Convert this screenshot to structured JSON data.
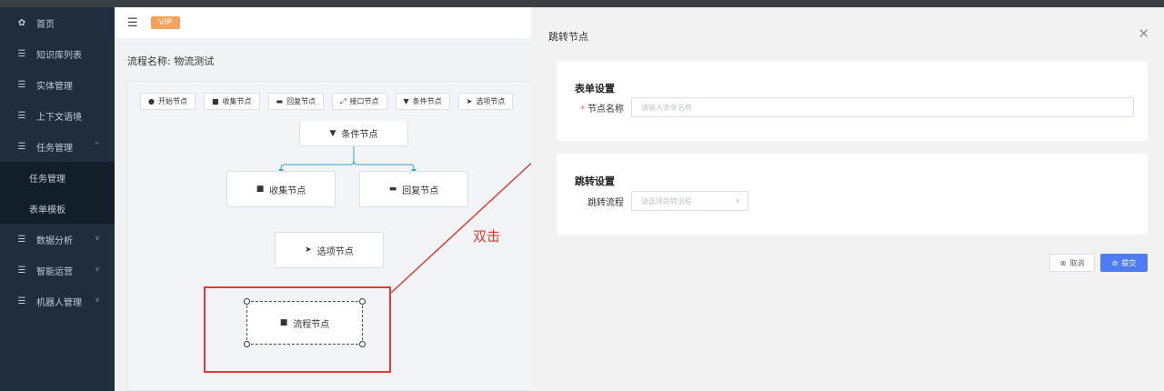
{
  "sidebar": {
    "items": [
      {
        "icon": "dashboard-icon",
        "glyph": "✿",
        "label": "首页"
      },
      {
        "icon": "list-icon",
        "glyph": "☰",
        "label": "知识库列表"
      },
      {
        "icon": "list-icon",
        "glyph": "☰",
        "label": "实体管理"
      },
      {
        "icon": "list-icon",
        "glyph": "☰",
        "label": "上下文语境"
      },
      {
        "icon": "list-icon",
        "glyph": "☰",
        "label": "任务管理",
        "expanded": true
      }
    ],
    "sub_items": [
      "任务管理",
      "表单模板"
    ],
    "items_after": [
      {
        "icon": "list-icon",
        "glyph": "☰",
        "label": "数据分析"
      },
      {
        "icon": "list-icon",
        "glyph": "☰",
        "label": "智能运营"
      },
      {
        "icon": "list-icon",
        "glyph": "☰",
        "label": "机器人管理"
      }
    ],
    "chevron_up": "^",
    "chevron_down": "∨"
  },
  "header": {
    "menu_glyph": "☰",
    "vip_label": "VIP"
  },
  "flow": {
    "name_label": "流程名称: 物流测试"
  },
  "toolbar": {
    "tools": [
      {
        "glyph": "●",
        "label": "开始节点"
      },
      {
        "glyph": "■",
        "label": "收集节点"
      },
      {
        "glyph": "▬",
        "label": "回复节点"
      },
      {
        "glyph": "⤢",
        "label": "接口节点"
      },
      {
        "glyph": "▼",
        "label": "条件节点"
      },
      {
        "glyph": "➤",
        "label": "选项节点"
      }
    ]
  },
  "canvas": {
    "condition_node": {
      "glyph": "▼",
      "label": "条件节点"
    },
    "collect_node": {
      "glyph": "■",
      "label": "收集节点"
    },
    "reply_node": {
      "glyph": "▬",
      "label": "回复节点"
    },
    "option_node": {
      "glyph": "➤",
      "label": "选项节点"
    },
    "flow_node": {
      "glyph": "■",
      "label": "流程节点"
    }
  },
  "annotation": {
    "label": "双击",
    "color": "#e03c31"
  },
  "drawer": {
    "title": "跳转节点",
    "close_glyph": "✕",
    "form_section": {
      "title": "表单设置",
      "required_mark": "*",
      "name_label": "节点名称",
      "name_placeholder": "请输入表单名称"
    },
    "jump_section": {
      "title": "跳转设置",
      "flow_label": "跳转流程",
      "flow_placeholder": "请选择跳转流程",
      "chevron": "∨"
    },
    "cancel_label": "取消",
    "cancel_glyph": "⊗",
    "submit_label": "提交",
    "submit_glyph": "⊘"
  },
  "colors": {
    "sidebar_bg": "#1f2d3d",
    "accent": "#4d7cf5",
    "vip": "#f4a35f",
    "connector": "#3aa0d0"
  }
}
